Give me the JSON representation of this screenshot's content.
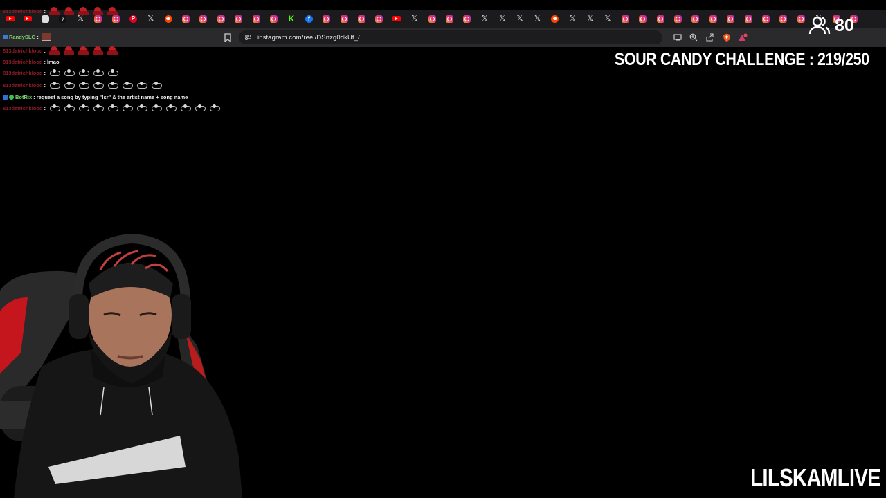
{
  "browser": {
    "tabs": [
      "ig",
      "ig",
      "pin",
      "x",
      "reddit",
      "ig",
      "ig",
      "ig",
      "ig",
      "ig",
      "ig",
      "kick",
      "fb",
      "ig",
      "ig",
      "ig",
      "ig",
      "yt",
      "x",
      "ig",
      "ig",
      "ig",
      "x",
      "x",
      "x",
      "x",
      "reddit",
      "x",
      "x",
      "x",
      "ig",
      "ig",
      "ig",
      "ig",
      "ig",
      "ig",
      "ig",
      "ig",
      "ig",
      "ig",
      "ig",
      "x",
      "ig",
      "ig"
    ],
    "left_tabs": [
      "yt",
      "yt",
      "blank",
      "tt",
      "x"
    ],
    "url": "instagram.com/reel/DSnzg0dkUf_/",
    "toolbar_icons": [
      "cast-icon",
      "zoom-icon",
      "share-icon",
      "brave-shield-icon",
      "brave-rewards-icon"
    ]
  },
  "chat": {
    "lines": [
      {
        "user": "813datrichklood",
        "message": "",
        "emotes": [
          "red",
          "red",
          "red",
          "red",
          "red"
        ],
        "badge": ""
      },
      {
        "user": "RandySLG",
        "message": "",
        "emotes": [
          "thumb"
        ],
        "badge": "mod",
        "green": true
      },
      {
        "user": "813datrichklood",
        "message": "",
        "emotes": [
          "red",
          "red",
          "red",
          "red",
          "red"
        ],
        "badge": ""
      },
      {
        "user": "813datrichklood",
        "message": "lmao",
        "emotes": [],
        "badge": ""
      },
      {
        "user": "813datrichklood",
        "message": "",
        "emotes": [
          "grey",
          "grey",
          "grey",
          "grey",
          "grey"
        ],
        "badge": ""
      },
      {
        "user": "813datrichklood",
        "message": "",
        "emotes": [
          "grey",
          "grey",
          "grey",
          "grey",
          "grey",
          "grey",
          "grey",
          "grey"
        ],
        "badge": ""
      },
      {
        "user": "BotRix",
        "message": "request a song by typing \"!sr\" & the artist name + song name",
        "emotes": [],
        "badge": "bot",
        "green": true
      },
      {
        "user": "813datrichklood",
        "message": "",
        "emotes": [
          "grey",
          "grey",
          "grey",
          "grey",
          "grey",
          "grey",
          "grey",
          "grey",
          "grey",
          "grey",
          "grey",
          "grey"
        ],
        "badge": ""
      }
    ]
  },
  "overlay": {
    "viewer_count": "80",
    "challenge": "SOUR CANDY CHALLENGE : 219/250",
    "brand": "LILSKAMLIVE"
  },
  "colors": {
    "background": "#000000",
    "chat_user": "#8e1c27",
    "chat_user_green": "#7bd36b"
  }
}
